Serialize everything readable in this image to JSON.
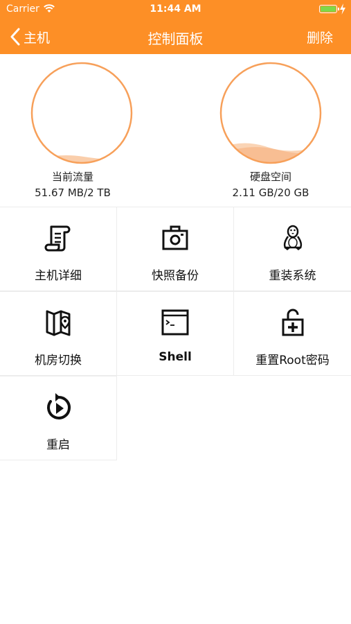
{
  "status_bar": {
    "carrier": "Carrier",
    "time": "11:44 AM"
  },
  "nav": {
    "back_label": "主机",
    "title": "控制面板",
    "action_label": "删除"
  },
  "traffic": {
    "label": "当前流量",
    "value": "51.67 MB/2 TB",
    "fraction": 0.025
  },
  "disk": {
    "label": "硬盘空间",
    "value": "2.11 GB/20 GB",
    "fraction": 0.105
  },
  "actions": [
    {
      "label": "主机详细",
      "icon": "scroll-icon"
    },
    {
      "label": "快照备份",
      "icon": "camera-icon"
    },
    {
      "label": "重装系统",
      "icon": "linux-penguin-icon"
    },
    {
      "label": "机房切换",
      "icon": "map-pin-icon"
    },
    {
      "label": "Shell",
      "icon": "terminal-icon"
    },
    {
      "label": "重置Root密码",
      "icon": "unlock-plus-icon"
    },
    {
      "label": "重启",
      "icon": "restart-icon"
    }
  ],
  "colors": {
    "accent": "#fd8f26",
    "wave": "#f9c9a2",
    "battery": "#7fd84a"
  }
}
